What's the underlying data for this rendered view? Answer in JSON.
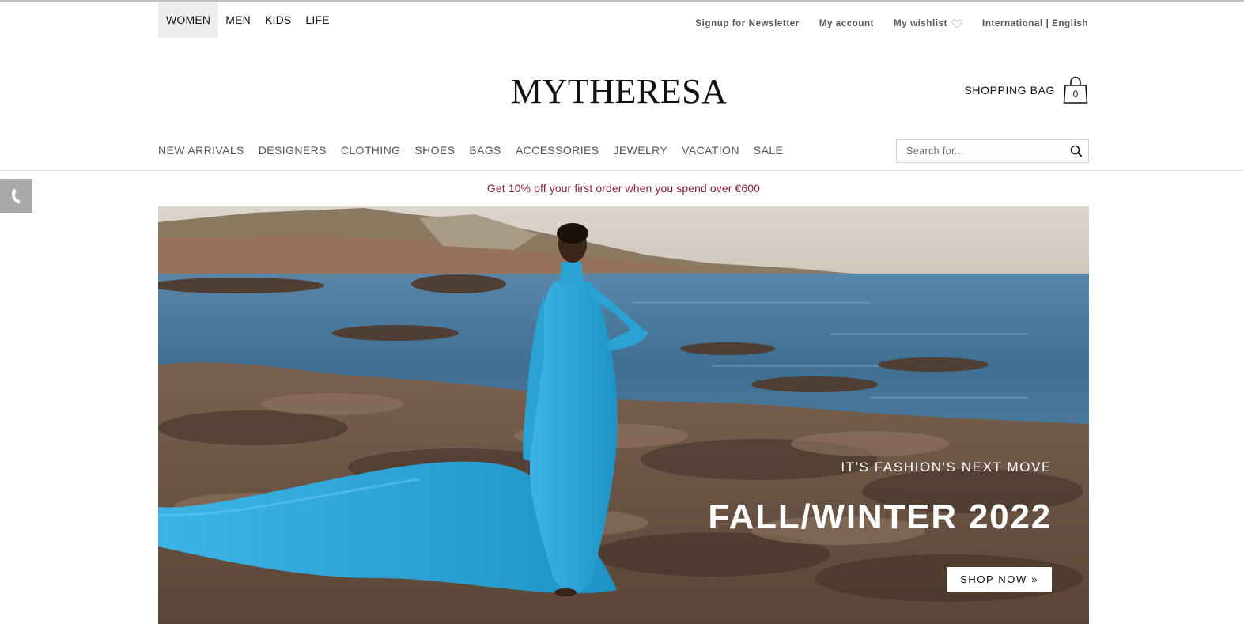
{
  "gender_tabs": [
    {
      "label": "WOMEN",
      "active": true
    },
    {
      "label": "MEN",
      "active": false
    },
    {
      "label": "KIDS",
      "active": false
    },
    {
      "label": "LIFE",
      "active": false
    }
  ],
  "utility": {
    "newsletter": "Signup for Newsletter",
    "account": "My account",
    "wishlist": "My wishlist",
    "locale": "International | English"
  },
  "logo": "MYTHERESA",
  "bag": {
    "label": "SHOPPING BAG",
    "count": "0"
  },
  "main_nav": [
    "NEW ARRIVALS",
    "DESIGNERS",
    "CLOTHING",
    "SHOES",
    "BAGS",
    "ACCESSORIES",
    "JEWELRY",
    "VACATION",
    "SALE"
  ],
  "search": {
    "placeholder": "Search for...",
    "value": ""
  },
  "promo": "Get 10% off your first order when you spend over €600",
  "hero": {
    "kicker": "IT'S FASHION'S NEXT MOVE",
    "title": "FALL/WINTER 2022",
    "cta": "SHOP NOW »"
  },
  "colors": {
    "promo": "#8a1d35",
    "dress": "#2aa3d4",
    "sea": "#3f6f93",
    "rocks": "#6b5544",
    "phone_tab": "#a9a9a9"
  },
  "icons": [
    "heart-icon",
    "shopping-bag-icon",
    "search-icon",
    "phone-icon"
  ]
}
